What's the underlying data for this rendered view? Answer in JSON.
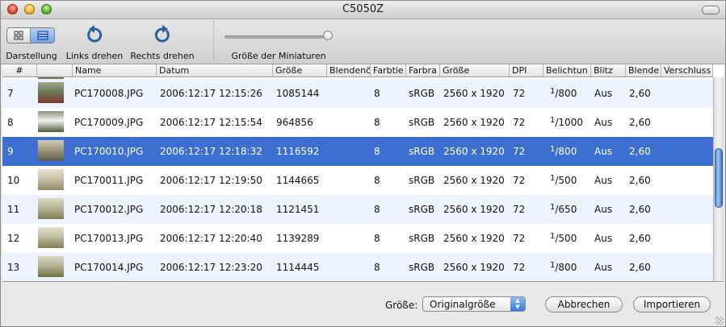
{
  "window": {
    "title": "C5050Z"
  },
  "toolbar": {
    "view_label": "Darstellung",
    "rotate_left_label": "Links drehen",
    "rotate_right_label": "Rechts drehen",
    "thumbnail_size_label": "Größe der Miniaturen",
    "thumbnail_size_value": 1.0
  },
  "table": {
    "columns": [
      "#",
      "",
      "Name",
      "Datum",
      "Größe",
      "Blendenö",
      "Farbtie",
      "Farbra",
      "Größe",
      "DPI",
      "Belichtun",
      "Blitz",
      "Blende",
      "Verschluss"
    ],
    "rows": [
      {
        "num": "7",
        "name": "PC170008.JPG",
        "date": "2006:12:17 12:15:26",
        "size": "1085144",
        "depth": "8",
        "colorspace": "sRGB",
        "dimensions": "2560 x 1920",
        "dpi": "72",
        "exp_num": "1",
        "exp_den": "/800",
        "flash": "Aus",
        "aperture": "2,60",
        "shutter": "",
        "thumb_colors": [
          "#6b7a59",
          "#7b3b2a",
          "#a3a78f"
        ],
        "selected": false
      },
      {
        "num": "8",
        "name": "PC170009.JPG",
        "date": "2006:12:17 12:15:54",
        "size": "964856",
        "depth": "8",
        "colorspace": "sRGB",
        "dimensions": "2560 x 1920",
        "dpi": "72",
        "exp_num": "1",
        "exp_den": "/1000",
        "flash": "Aus",
        "aperture": "2,60",
        "shutter": "",
        "thumb_colors": [
          "#f2f2f2",
          "#4d5a3c",
          "#8e8f7e"
        ],
        "selected": false
      },
      {
        "num": "9",
        "name": "PC170010.JPG",
        "date": "2006:12:17 12:18:32",
        "size": "1116592",
        "depth": "8",
        "colorspace": "sRGB",
        "dimensions": "2560 x 1920",
        "dpi": "72",
        "exp_num": "1",
        "exp_den": "/800",
        "flash": "Aus",
        "aperture": "2,60",
        "shutter": "",
        "thumb_colors": [
          "#a39a7f",
          "#5f5a4b",
          "#d2cdb8"
        ],
        "selected": true
      },
      {
        "num": "10",
        "name": "PC170011.JPG",
        "date": "2006:12:17 12:19:50",
        "size": "1144665",
        "depth": "8",
        "colorspace": "sRGB",
        "dimensions": "2560 x 1920",
        "dpi": "72",
        "exp_num": "1",
        "exp_den": "/500",
        "flash": "Aus",
        "aperture": "2,60",
        "shutter": "",
        "thumb_colors": [
          "#c9c2a8",
          "#8d8b62",
          "#e4e0cf"
        ],
        "selected": false
      },
      {
        "num": "11",
        "name": "PC170012.JPG",
        "date": "2006:12:17 12:20:18",
        "size": "1121451",
        "depth": "8",
        "colorspace": "sRGB",
        "dimensions": "2560 x 1920",
        "dpi": "72",
        "exp_num": "1",
        "exp_den": "/650",
        "flash": "Aus",
        "aperture": "2,60",
        "shutter": "",
        "thumb_colors": [
          "#b9b79a",
          "#7f7c52",
          "#dcd9c6"
        ],
        "selected": false
      },
      {
        "num": "12",
        "name": "PC170013.JPG",
        "date": "2006:12:17 12:20:40",
        "size": "1139289",
        "depth": "8",
        "colorspace": "sRGB",
        "dimensions": "2560 x 1920",
        "dpi": "72",
        "exp_num": "1",
        "exp_den": "/500",
        "flash": "Aus",
        "aperture": "2,60",
        "shutter": "",
        "thumb_colors": [
          "#c2bfa3",
          "#7d8153",
          "#e2dfcd"
        ],
        "selected": false
      },
      {
        "num": "13",
        "name": "PC170014.JPG",
        "date": "2006:12:17 12:23:20",
        "size": "1114445",
        "depth": "8",
        "colorspace": "sRGB",
        "dimensions": "2560 x 1920",
        "dpi": "72",
        "exp_num": "1",
        "exp_den": "/800",
        "flash": "Aus",
        "aperture": "2,60",
        "shutter": "",
        "thumb_colors": [
          "#b8b396",
          "#6d7346",
          "#d9d5c0"
        ],
        "selected": false
      }
    ]
  },
  "footer": {
    "size_label": "Größe:",
    "size_value": "Originalgröße",
    "cancel_label": "Abbrechen",
    "import_label": "Importieren"
  },
  "colors": {
    "selection": "#3d6fd0",
    "alt_row": "#edf3fe",
    "accent": "#3a78d8"
  }
}
